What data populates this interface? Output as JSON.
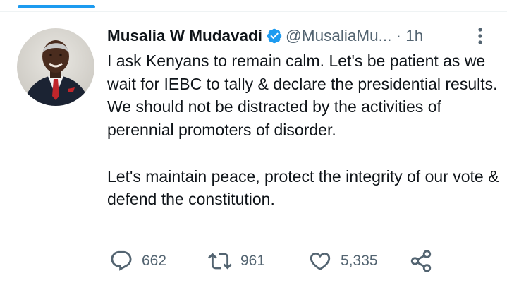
{
  "tweet": {
    "author_name": "Musalia W Mudavadi",
    "author_handle": "@MusaliaMu...",
    "dot": "·",
    "time_ago": "1h",
    "text": "I ask Kenyans to remain calm. Let's be patient as we wait for IEBC to tally & declare the presidential results. We should not be distracted by the activities of perennial promoters of disorder.\n\nLet's maintain peace, protect the integrity of our vote & defend the constitution.",
    "stats": {
      "replies": "662",
      "retweets": "961",
      "likes": "5,335"
    }
  },
  "icons": {
    "verified": "verified-badge-icon",
    "more": "more-vertical-icon",
    "reply": "reply-icon",
    "retweet": "retweet-icon",
    "like": "heart-icon",
    "share": "share-icon"
  },
  "colors": {
    "accent": "#1d9bf0",
    "text_primary": "#0f1419",
    "text_secondary": "#536471"
  }
}
